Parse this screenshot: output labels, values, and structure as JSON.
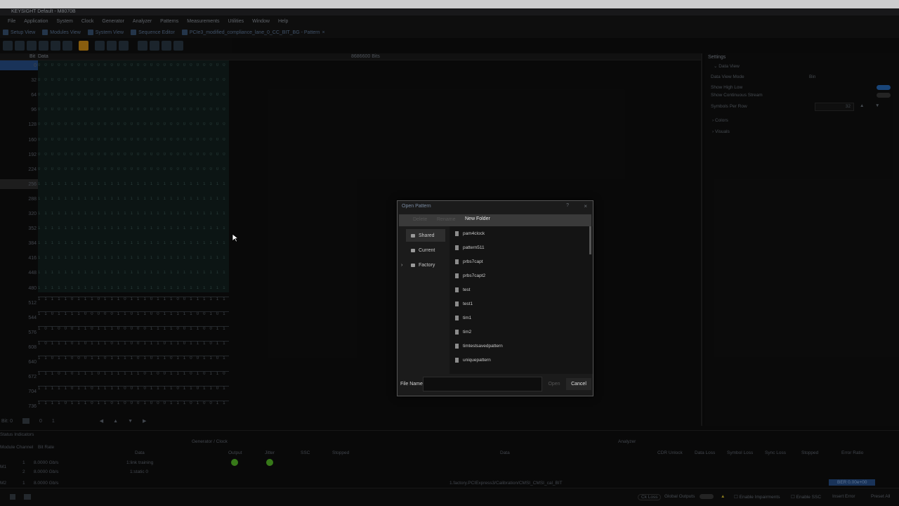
{
  "app": {
    "title": "KEYSIGHT  Default - M8070B"
  },
  "menu": [
    "File",
    "Application",
    "System",
    "Clock",
    "Generator",
    "Analyzer",
    "Patterns",
    "Measurements",
    "Utilities",
    "Window",
    "Help"
  ],
  "tabs": [
    "Setup View",
    "Modules View",
    "System View",
    "Sequence Editor",
    "PCIe3_modified_compliance_lane_0_CC_BIT_BG - Pattern"
  ],
  "bit_view": {
    "header_label": "Bit",
    "header_data": "Data",
    "total_bits": "8686600 Bits",
    "row_labels": [
      "0",
      "32",
      "64",
      "96",
      "128",
      "160",
      "192",
      "224",
      "256",
      "288",
      "320",
      "352",
      "384",
      "416",
      "448",
      "480",
      "512",
      "544",
      "576",
      "608",
      "640",
      "672",
      "704",
      "736"
    ],
    "grid_row_text": "0 0 0 0 0 0 0 0 0 0 0 0 0 0 0 0 0 0 0 0 0 0 0 0 0 0 0 0 0 0 0 0",
    "grid_row_text_ones": "1 1 1 1 1 1 1 1 1 1 1 1 1 1 1 1 1 1 1 1 1 1 1 1 1 1 1 1 1 1 1 1",
    "wave_rows": [
      "1 1 1 1 1 0 1 1 1 0 1 1 1 0 1 1 1 0 1 1 1 0 0 1 1 1 1 1 1 0 1 1",
      "1 1 0 1 1 1 1 0 0 0 0 0 1 1 0 1 1 0 0 1 1 1 1 1 0 0 1 0 1 1 0 0",
      "1 0 1 0 0 0 1 1 0 1 1 1 0 0 0 0 0 1 1 1 1 0 0 1 1 0 0 1 1 1 1 0",
      "1 0 1 1 1 0 1 0 1 1 1 0 1 1 0 0 1 1 1 0 1 1 0 1 1 1 0 1 1 1 0 0",
      "1 1 0 1 1 0 0 0 1 1 0 1 1 1 1 0 1 0 1 1 0 1 1 0 0 1 1 0 1 1 0 1",
      "1 1 1 0 1 0 1 1 1 0 1 1 1 1 1 1 0 1 0 0 1 1 1 0 1 0 1 1 0 1 1 1",
      "1 1 1 1 1 0 1 1 0 1 1 1 1 0 0 1 0 1 1 1 1 0 1 1 0 1 1 0 1 1 0 0",
      "1 1 1 1 0 1 1 1 0 1 1 0 1 0 0 0 1 0 0 0 1 1 1 0 1 0 0 1 1 1 1 1"
    ],
    "footer": {
      "bit_label": "Bit",
      "bit_value": "0",
      "index": "0",
      "page": "1"
    }
  },
  "settings": {
    "title": "Settings",
    "section_data_view": "Data View",
    "data_view_mode_label": "Data View Mode",
    "data_view_mode_value": "Bin",
    "show_high_low": "Show High Low",
    "show_continuous_stream": "Show Continuous Stream",
    "symbols_per_row_label": "Symbols Per Row",
    "symbols_per_row_value": "32",
    "colors": "Colors",
    "visuals": "Visuals"
  },
  "status": {
    "title": "Status Indicators",
    "generator_clock": "Generator / Clock",
    "analyzer": "Analyzer",
    "col_module_channel": "Module Channel",
    "col_bit_rate": "Bit Rate",
    "col_data": "Data",
    "col_output": "Output",
    "col_jitter": "Jitter",
    "col_ssc": "SSC",
    "col_stopped": "Stopped",
    "analyzer_cols": [
      "Data",
      "CDR Unlock",
      "Data Loss",
      "Symbol Loss",
      "Sync Loss",
      "Stopped",
      "Error Ratio"
    ],
    "rows": [
      {
        "module": "M1",
        "channel": "1",
        "bitrate": "8.0000 Gb/s",
        "data": "1:link training"
      },
      {
        "module": "",
        "channel": "2",
        "bitrate": "8.0000 Gb/s",
        "data": "1:static 0"
      },
      {
        "module": "M2",
        "channel": "1",
        "bitrate": "8.0000 Gb/s",
        "data": "1.factory.PCIExpress3/Calibration/CMSI_CMSI_cal_BIT",
        "error_ratio": "BER 0.00e+00"
      }
    ]
  },
  "statusbar": {
    "ck_loss": "Ck Loss",
    "global_outputs": "Global Outputs",
    "enable_impairments": "Enable Impairments",
    "enable_ssc": "Enable SSC",
    "insert_error": "Insert Error",
    "preset_all": "Preset All"
  },
  "dialog": {
    "title": "Open Pattern",
    "help": "?",
    "close": "×",
    "toolbar_delete": "Delete",
    "toolbar_rename": "Rename",
    "new_folder": "New Folder",
    "folders": [
      "Shared",
      "Current",
      "Factory"
    ],
    "files": [
      "pam4clock",
      "pattern511",
      "prbs7capt",
      "prbs7capt2",
      "test",
      "test1",
      "tim1",
      "tim2",
      "timtestsavedpattern",
      "uniquepattern"
    ],
    "file_name_label": "File Name",
    "file_name_value": "",
    "open": "Open",
    "cancel": "Cancel"
  },
  "colors": {
    "accent": "#1d3b66",
    "output_indicator": "#3f8a1d",
    "dialog_bg": "#1b1b1b"
  }
}
